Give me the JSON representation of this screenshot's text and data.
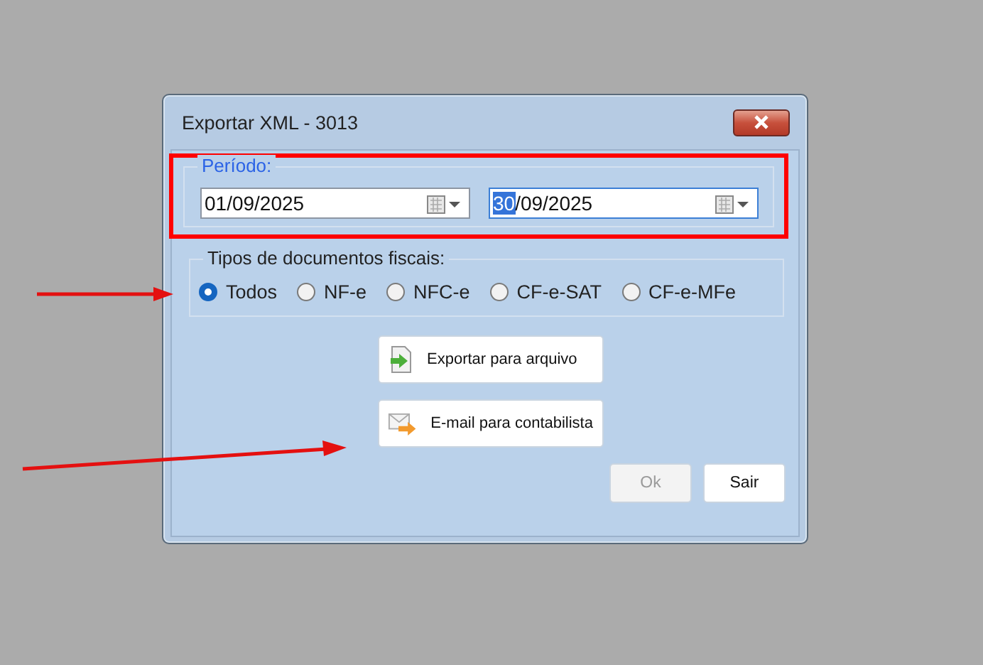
{
  "window": {
    "title": "Exportar XML - 3013"
  },
  "period": {
    "label": "Período:",
    "from": {
      "value": "01/09/2025"
    },
    "to": {
      "selected_text": "30",
      "value": "/09/2025"
    }
  },
  "document_types": {
    "label": "Tipos de documentos fiscais:",
    "options": [
      {
        "label": "Todos",
        "selected": true
      },
      {
        "label": "NF-e",
        "selected": false
      },
      {
        "label": "NFC-e",
        "selected": false
      },
      {
        "label": "CF-e-SAT",
        "selected": false
      },
      {
        "label": "CF-e-MFe",
        "selected": false
      }
    ]
  },
  "actions": [
    {
      "kind": "file",
      "label": "Exportar para arquivo"
    },
    {
      "kind": "email",
      "label": "E-mail para contabilista"
    }
  ],
  "buttons": [
    {
      "label": "Ok",
      "disabled": true
    },
    {
      "label": "Sair",
      "disabled": false
    }
  ]
}
